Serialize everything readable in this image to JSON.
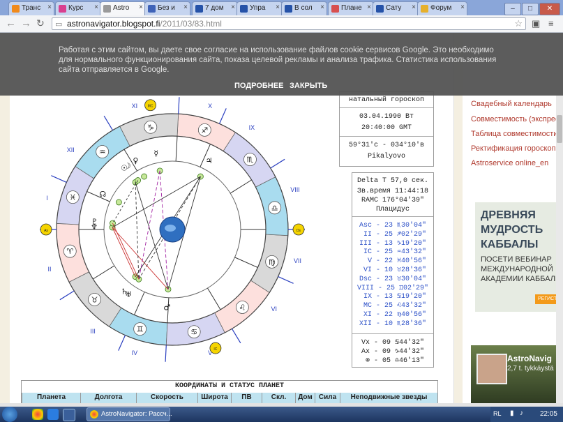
{
  "browser": {
    "tabs": [
      {
        "label": "Транс",
        "color": "#f08a1c"
      },
      {
        "label": "Курс",
        "color": "#d93f8f"
      },
      {
        "label": "Astro",
        "color": "#9a9a9a"
      },
      {
        "label": "Без и",
        "color": "#3f63b8"
      },
      {
        "label": "7 дом",
        "color": "#2552a8"
      },
      {
        "label": "Упра",
        "color": "#2552a8"
      },
      {
        "label": "В сол",
        "color": "#2552a8"
      },
      {
        "label": "Плане",
        "color": "#d85050"
      },
      {
        "label": "Сату",
        "color": "#2552a8"
      },
      {
        "label": "Форум",
        "color": "#e6b02c"
      }
    ],
    "url_host": "astronavigator.blogspot.fi",
    "url_path": "/2011/03/83.html",
    "window_buttons": [
      "–",
      "□",
      "✕"
    ]
  },
  "cookie_banner": {
    "message": "Работая с этим сайтом, вы даете свое согласие на использование файлов cookie сервисов Google. Это необходимо для нормального функционирования сайта, показа целевой рекламы и анализа трафика. Статистика использования сайта отправляется в Google.",
    "more_label": "ПОДРОБНЕЕ",
    "accept_label": "ЗАКРЫТЬ"
  },
  "natal_info": {
    "title": "натальный гороскоп",
    "date": "03.04.1990 Вт",
    "time": "20:40:00 GMT",
    "coords": "59°31'с - 034°10'в",
    "place": "Pikalyovo"
  },
  "delta_info": {
    "delta_t": "Delta T  57,0 сек.",
    "star_time": "Зв.время 11:44:18",
    "ramc": "RAMC 176°04'39\"",
    "system": "Плацидус"
  },
  "cusps": [
    "Asc - 23 ♏30'04\"",
    " II - 25 ♐02'29\"",
    "III - 13 ♑19'20\"",
    " IC - 25 ♒43'32\"",
    "  V - 22 ♓40'56\"",
    " VI - 10 ♉28'36\"",
    "Dsc - 23 ♉30'04\"",
    "VIII - 25 ♊02'29\"",
    " IX - 13 ♋19'20\"",
    " MC - 25 ♌43'32\"",
    " XI - 22 ♍40'56\"",
    "XII - 10 ♏28'36\""
  ],
  "nodes": [
    "Vx - 09 ♋44'32\"",
    "Ax - 09 ♑44'32\"",
    " ⊗ - 05 ♎46'13\""
  ],
  "coords_table": {
    "title": "КООРДИНАТЫ И СТАТУС ПЛАНЕТ",
    "headers": [
      "Планета",
      "Долгота",
      "Скорость",
      "Широта",
      "ПВ",
      "Скл.",
      "Дом",
      "Сила",
      "Неподвижные звезды"
    ]
  },
  "sidebar_links": [
    "Свадебный календарь",
    "Совместимость (экспресс",
    "Таблица совместимости",
    "Ректификация гороскоп",
    "Astroservice online_en"
  ],
  "ad": {
    "headline": "ДРЕВНЯЯ\nМУДРОСТЬ\nКАББАЛЫ",
    "body": "ПОСЕТИ ВЕБИНАР\nМЕЖДУНАРОДНОЙ\nАКАДЕМИИ КАББАЛЫ",
    "button": "РЕГИСТ"
  },
  "profile": {
    "name": "AstroNavig",
    "sub": "2,7 t. tykkäystä"
  },
  "chart": {
    "house_numerals": [
      "I",
      "II",
      "III",
      "IV",
      "V",
      "VI",
      "VII",
      "VIII",
      "IX",
      "X",
      "XI",
      "XII"
    ],
    "sign_glyphs": [
      "♈",
      "♉",
      "♊",
      "♋",
      "♌",
      "♍",
      "♎",
      "♏",
      "♐",
      "♑",
      "♒",
      "♓"
    ],
    "planet_glyphs": [
      "☉",
      "☽",
      "☿",
      "♀",
      "♂",
      "♃",
      "♄",
      "♅",
      "♆",
      "♇",
      "☊"
    ],
    "marker_labels": [
      "MC",
      "Ds",
      "IC",
      "As"
    ]
  },
  "taskbar": {
    "item_label": "AstroNavigator: Рассч...",
    "lang": "RL",
    "time": "22:05"
  }
}
